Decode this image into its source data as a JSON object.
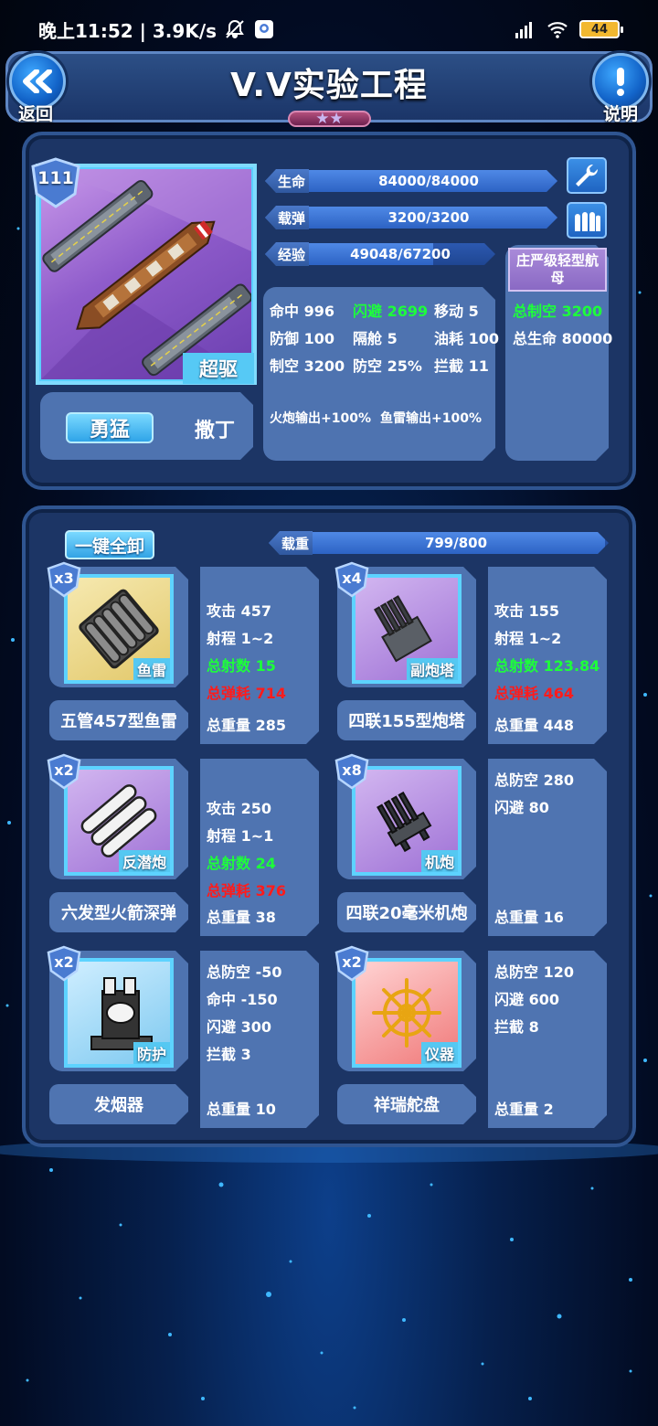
{
  "status_bar": {
    "time": "晚上11:52 | 3.9K/s",
    "battery": "44"
  },
  "header": {
    "title": "V.V实验工程",
    "back_label": "返回",
    "info_label": "说明",
    "star_rating": "★★"
  },
  "ship": {
    "level": "111",
    "class_label": "超驱",
    "trait": "勇猛",
    "captain": "撒丁",
    "type": "庄严级轻型航母",
    "hp": {
      "label": "生命",
      "value": "84000/84000",
      "fill": 1.0
    },
    "ammo": {
      "label": "载弹",
      "value": "3200/3200",
      "fill": 1.0
    },
    "exp": {
      "label": "经验",
      "value": "49048/67200",
      "fill": 0.73
    },
    "stats": {
      "accuracy": "命中 996",
      "evasion": "闪避 2699",
      "mobility": "移动 5",
      "defense": "防御 100",
      "compartment": "隔舱 5",
      "fuel": "油耗 100",
      "air_control": "制空 3200",
      "anti_air": "防空 25%",
      "intercept": "拦截 11",
      "gun_bonus": "火炮输出+100%",
      "torpedo_bonus": "鱼雷输出+100%"
    },
    "totals": {
      "total_air": "总制空 3200",
      "total_hp": "总生命 80000"
    }
  },
  "loadout": {
    "unload_all": "一键全卸",
    "weight": {
      "label": "载重",
      "value": "799/800",
      "fill": 0.99
    },
    "items": [
      {
        "count": "x3",
        "category": "鱼雷",
        "name": "五管457型鱼雷",
        "stats": [
          {
            "text": "攻击 457",
            "color": "white"
          },
          {
            "text": "射程 1~2",
            "color": "white"
          },
          {
            "text": "总射数 15",
            "color": "green"
          },
          {
            "text": "总弹耗 714",
            "color": "red"
          },
          {
            "text": "总重量 285",
            "color": "white"
          }
        ]
      },
      {
        "count": "x4",
        "category": "副炮塔",
        "name": "四联155型炮塔",
        "stats": [
          {
            "text": "攻击 155",
            "color": "white"
          },
          {
            "text": "射程 1~2",
            "color": "white"
          },
          {
            "text": "总射数 123.84",
            "color": "green"
          },
          {
            "text": "总弹耗 464",
            "color": "red"
          },
          {
            "text": "总重量 448",
            "color": "white"
          }
        ]
      },
      {
        "count": "x2",
        "category": "反潜炮",
        "name": "六发型火箭深弹",
        "stats": [
          {
            "text": "攻击 250",
            "color": "white"
          },
          {
            "text": "射程 1~1",
            "color": "white"
          },
          {
            "text": "总射数 24",
            "color": "green"
          },
          {
            "text": "总弹耗 376",
            "color": "red"
          },
          {
            "text": "总重量 38",
            "color": "white"
          }
        ]
      },
      {
        "count": "x8",
        "category": "机炮",
        "name": "四联20毫米机炮",
        "stats": [
          {
            "text": "总防空 280",
            "color": "white"
          },
          {
            "text": "闪避 80",
            "color": "white"
          },
          {
            "text": "总重量 16",
            "color": "white"
          }
        ]
      },
      {
        "count": "x2",
        "category": "防护",
        "name": "发烟器",
        "stats": [
          {
            "text": "总防空 -50",
            "color": "white"
          },
          {
            "text": "命中 -150",
            "color": "white"
          },
          {
            "text": "闪避 300",
            "color": "white"
          },
          {
            "text": "拦截 3",
            "color": "white"
          },
          {
            "text": "总重量 10",
            "color": "white"
          }
        ]
      },
      {
        "count": "x2",
        "category": "仪器",
        "name": "祥瑞舵盘",
        "stats": [
          {
            "text": "总防空 120",
            "color": "white"
          },
          {
            "text": "闪避 600",
            "color": "white"
          },
          {
            "text": "拦截 8",
            "color": "white"
          },
          {
            "text": "总重量 2",
            "color": "white"
          }
        ]
      }
    ]
  },
  "colors": {
    "green_stat": "#1dff3a",
    "red_stat": "#ff1b1b",
    "accent_cyan": "#5dd3ff"
  }
}
